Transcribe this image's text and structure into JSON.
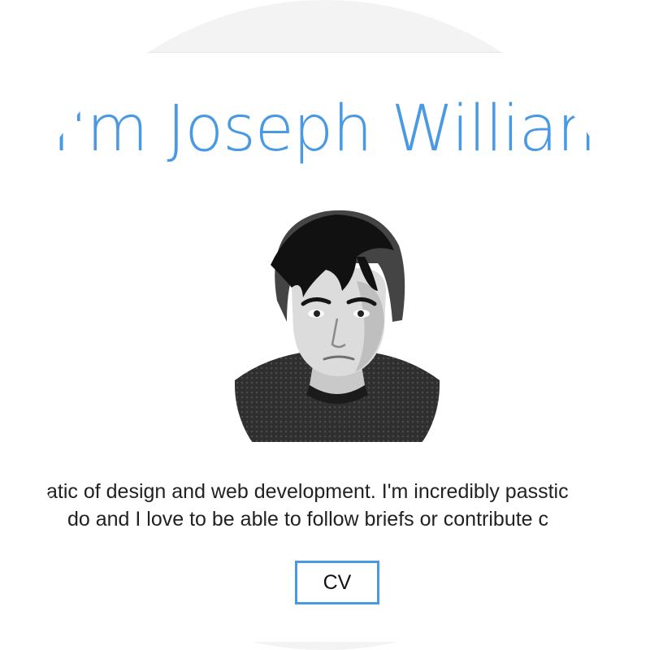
{
  "hero": {
    "heading": "Hi, I'm Joseph Williams",
    "avatar_alt": "Portrait photo"
  },
  "bio": {
    "line1": "atic of design and web development. I'm incredibly passtic",
    "line2": "do and I love to be able to follow briefs or contribute c"
  },
  "actions": {
    "cv_label": "CV"
  },
  "colors": {
    "accent": "#4a9ae3",
    "text": "#222222",
    "band": "#f3f3f3"
  }
}
